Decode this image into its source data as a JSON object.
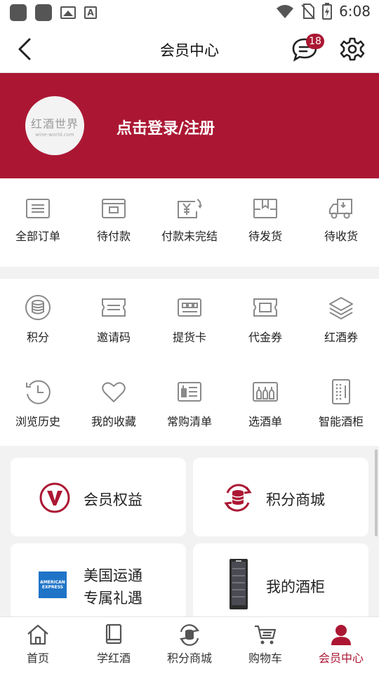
{
  "status_bar": {
    "time": "6:08"
  },
  "header": {
    "title": "会员中心",
    "message_count": "18"
  },
  "banner": {
    "logo_text": "红酒世界",
    "logo_sub": "wine-world.com",
    "login_label": "点击登录/注册"
  },
  "orders": [
    {
      "label": "全部订单",
      "icon": "all-orders-icon"
    },
    {
      "label": "待付款",
      "icon": "wallet-icon"
    },
    {
      "label": "付款未完结",
      "icon": "yen-refresh-icon"
    },
    {
      "label": "待发货",
      "icon": "package-icon"
    },
    {
      "label": "待收货",
      "icon": "truck-icon"
    }
  ],
  "services": [
    {
      "label": "积分",
      "icon": "coins-icon"
    },
    {
      "label": "邀请码",
      "icon": "ticket-icon"
    },
    {
      "label": "提货卡",
      "icon": "card-icon"
    },
    {
      "label": "代金券",
      "icon": "voucher-icon"
    },
    {
      "label": "红酒券",
      "icon": "layers-icon"
    },
    {
      "label": "浏览历史",
      "icon": "history-icon"
    },
    {
      "label": "我的收藏",
      "icon": "heart-icon"
    },
    {
      "label": "常购清单",
      "icon": "list-icon"
    },
    {
      "label": "选酒单",
      "icon": "bottles-icon"
    },
    {
      "label": "智能酒柜",
      "icon": "wine-cabinet-icon"
    }
  ],
  "cards": {
    "benefits": "会员权益",
    "points_mall": "积分商城",
    "amex_line1": "美国运通",
    "amex_line2": "专属礼遇",
    "amex_logo_top": "AMERICAN",
    "amex_logo_bottom": "EXPRESS",
    "cabinet": "我的酒柜"
  },
  "bottom_nav": [
    {
      "label": "首页",
      "icon": "home-icon"
    },
    {
      "label": "学红酒",
      "icon": "book-icon"
    },
    {
      "label": "积分商城",
      "icon": "points-icon"
    },
    {
      "label": "购物车",
      "icon": "cart-icon"
    },
    {
      "label": "会员中心",
      "icon": "user-icon"
    }
  ],
  "colors": {
    "accent": "#ab1733",
    "icon_gray": "#8a8a8a",
    "background": "#f2f2f2"
  }
}
